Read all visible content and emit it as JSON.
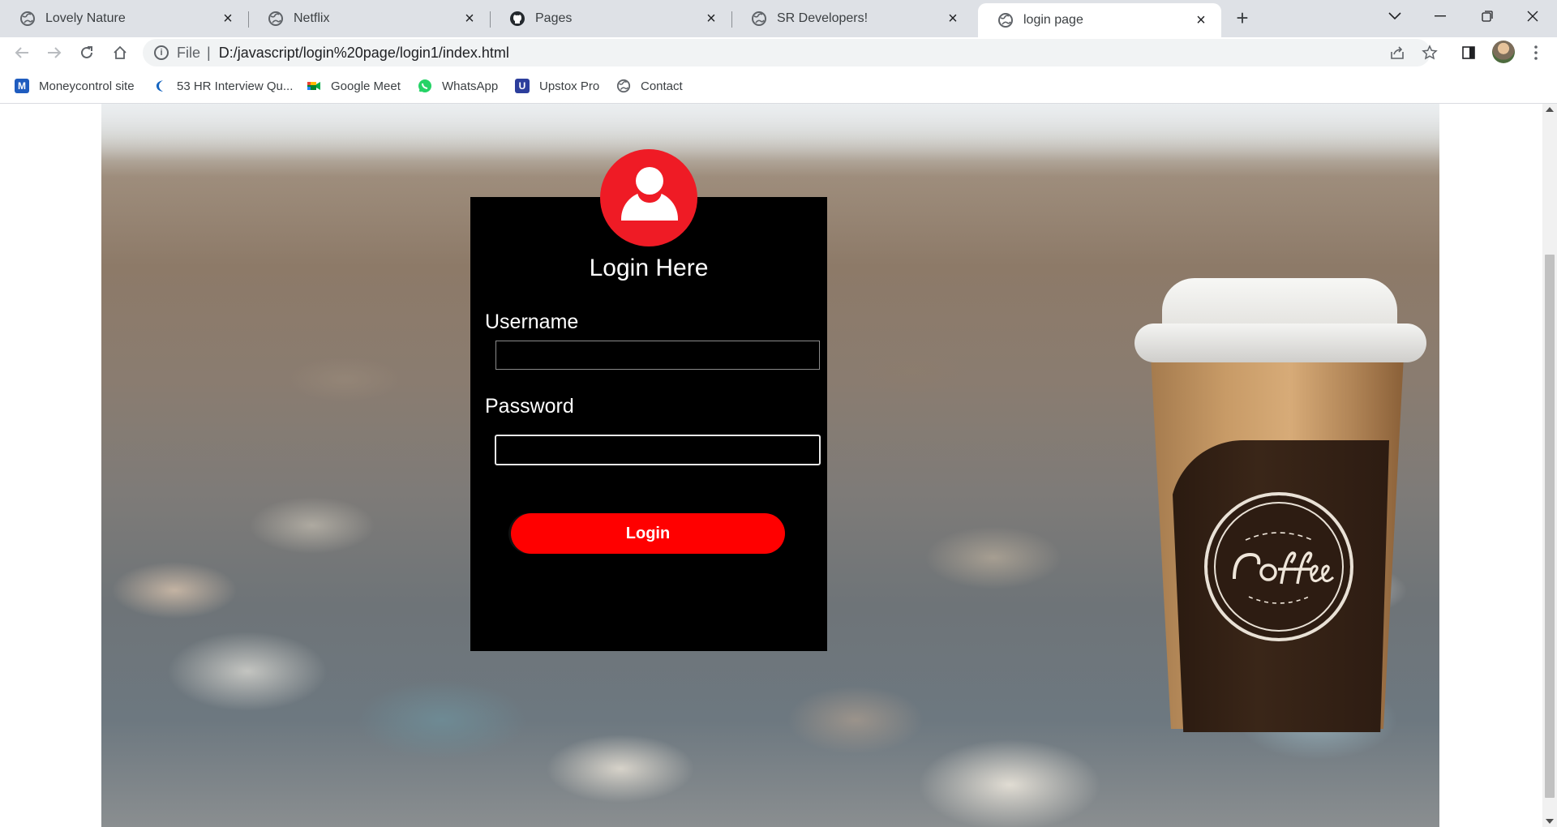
{
  "browser": {
    "tabs": [
      {
        "title": "Lovely Nature",
        "icon": "globe-icon",
        "active": false
      },
      {
        "title": "Netflix",
        "icon": "globe-icon",
        "active": false
      },
      {
        "title": "Pages",
        "icon": "github-icon",
        "active": false
      },
      {
        "title": "SR Developers!",
        "icon": "globe-icon",
        "active": false
      },
      {
        "title": "login page",
        "icon": "globe-icon",
        "active": true
      }
    ],
    "new_tab_glyph": "+",
    "close_glyph": "×",
    "address": {
      "scheme_label": "File",
      "separator": "|",
      "url": "D:/javascript/login%20page/login1/index.html"
    },
    "bookmarks": [
      {
        "label": "Moneycontrol site",
        "icon": "moneycontrol-icon",
        "color": "#1f5cbf"
      },
      {
        "label": "53 HR Interview Qu...",
        "icon": "indiabix-icon",
        "color": "#1565c0"
      },
      {
        "label": "Google Meet",
        "icon": "google-meet-icon",
        "color": "#00832d"
      },
      {
        "label": "WhatsApp",
        "icon": "whatsapp-icon",
        "color": "#25d366"
      },
      {
        "label": "Upstox Pro",
        "icon": "upstox-icon",
        "color": "#2c3e9c"
      },
      {
        "label": "Contact",
        "icon": "globe-icon",
        "color": "#5f6368"
      }
    ]
  },
  "page": {
    "login": {
      "title": "Login Here",
      "username_label": "Username",
      "username_value": "",
      "password_label": "Password",
      "password_value": "",
      "button_label": "Login"
    },
    "colors": {
      "card_bg": "#000000",
      "accent_red": "#ef1b25",
      "button_red": "#ff0000"
    }
  }
}
